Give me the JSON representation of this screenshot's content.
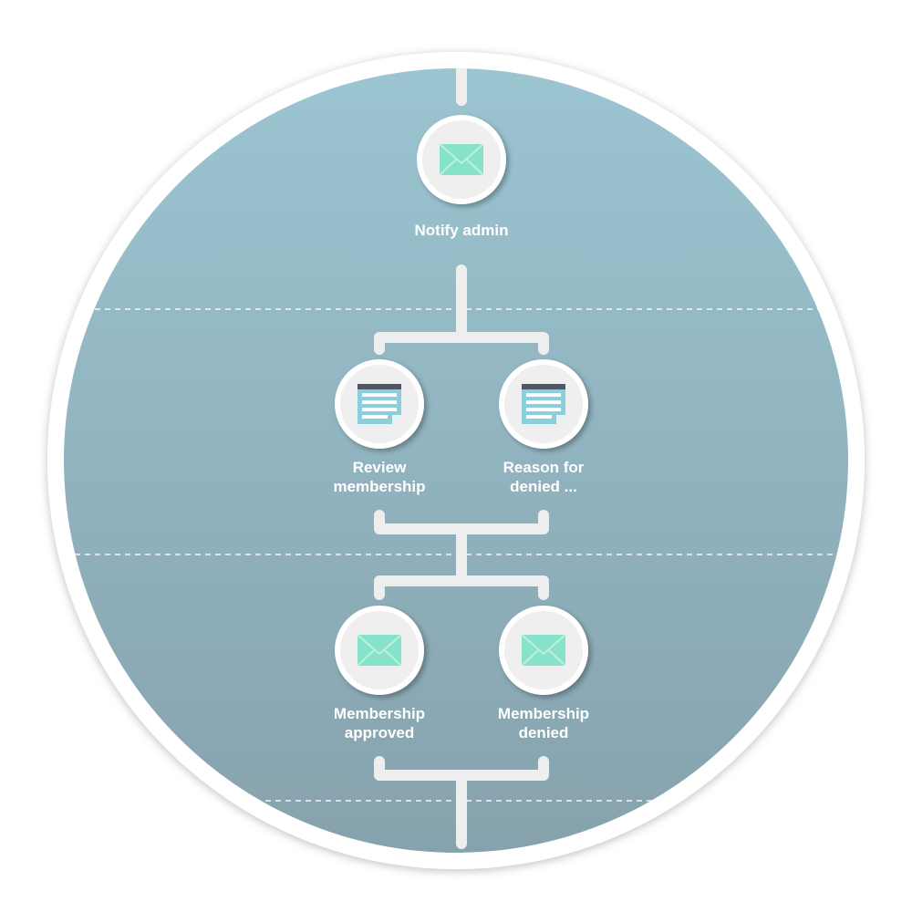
{
  "colors": {
    "background_top": "#9bc5d1",
    "background_bottom": "#86a2ad",
    "connector": "#eeeeee",
    "node_fill": "#efefef",
    "envelope": "#86e3c9",
    "document": "#8ccfdc",
    "document_header": "#4f5664"
  },
  "nodes": [
    {
      "label": "Notify admin",
      "icon": "envelope-icon"
    },
    {
      "label": "Review membership",
      "icon": "document-icon"
    },
    {
      "label": "Reason for denied ...",
      "icon": "document-icon"
    },
    {
      "label": "Membership approved",
      "icon": "envelope-icon"
    },
    {
      "label": "Membership denied",
      "icon": "envelope-icon"
    }
  ]
}
